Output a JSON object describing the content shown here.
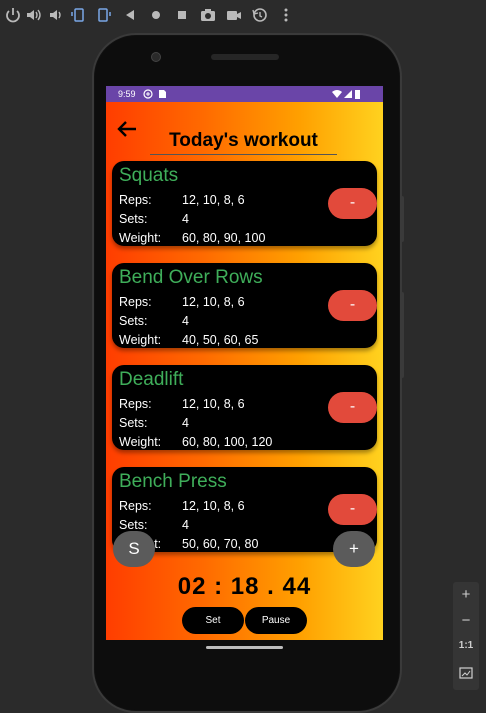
{
  "toolbar": {
    "icons": [
      "power-icon",
      "volume-up-icon",
      "volume-down-icon",
      "rotate-left-icon",
      "rotate-right-icon",
      "back-icon",
      "home-icon",
      "overview-icon",
      "camera-icon",
      "video-icon",
      "replay-icon",
      "more-icon"
    ]
  },
  "status": {
    "time": "9:59"
  },
  "app": {
    "title": "Today's workout",
    "labels": {
      "reps": "Reps:",
      "sets": "Sets:",
      "weight": "Weight:"
    },
    "remove_label": "-",
    "exercises": [
      {
        "name": "Squats",
        "reps": "12, 10, 8, 6",
        "sets": "4",
        "weight": "60, 80, 90, 100"
      },
      {
        "name": "Bend Over Rows",
        "reps": "12, 10, 8, 6",
        "sets": "4",
        "weight": "40, 50, 60, 65"
      },
      {
        "name": "Deadlift",
        "reps": "12, 10, 8, 6",
        "sets": "4",
        "weight": "60, 80, 100, 120"
      },
      {
        "name": "Bench Press",
        "reps": "12, 10, 8, 6",
        "sets": "4",
        "weight": "50, 60, 70, 80"
      }
    ],
    "fab_left": "S",
    "fab_right": "+",
    "timer": "02 : 18 . 44",
    "set_label": "Set",
    "pause_label": "Pause"
  },
  "zoom_panel": {
    "plus": "+",
    "minus": "−",
    "ratio": "1:1"
  },
  "colors": {
    "gradient_start": "#ff3d00",
    "gradient_end": "#ffd21f",
    "status_bar": "#6a45a8",
    "exercise_name": "#3fae5a",
    "remove_button": "#e24a3b"
  }
}
